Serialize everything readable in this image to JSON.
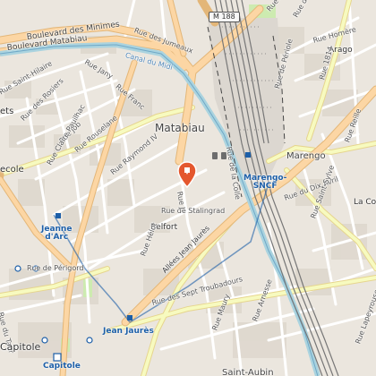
{
  "road_shield": "M 188",
  "labels": {
    "bd_minimes": "Boulevard des Minimes",
    "bd_matabiau": "Boulevard Matabiau",
    "canal_midi": "Canal du Midi",
    "rue_jumeaux": "Rue des Jumeaux",
    "rue_jany": "Rue Jany",
    "rue_franc": "Rue Franc",
    "rue_arago": "Rue Arago",
    "rue_homere": "Rue Homère",
    "arago": "Arago",
    "rue_peiriole": "Rue de Périole",
    "rue_1814": "Rue 1814",
    "rue_saint_hilaire": "Rue Saint-Hilaire",
    "rue_rosiers": "Rue des Rosiers",
    "rue_job": "Rue Job",
    "rue_claire_pauilhac": "Rue Claire Pauilhac",
    "rue_rouselane": "Rue Rouselane",
    "rue_raymond_iv": "Rue Raymond IV",
    "matabiau": "Matabiau",
    "marengo": "Marengo",
    "marengo_sncf": "Marengo-\nSNCF",
    "rue_dix_avril": "Rue du Dix Avril",
    "rue_reille": "Rue Reille",
    "la_colo": "La Colo",
    "rue_stalingrad": "Rue de Stalingrad",
    "belfort": "Belfort",
    "rue_helot": "Rue Hélot",
    "allees_jaures": "Allées Jean Jaurès",
    "jeanne_darc": "Jeanne\nd'Arc",
    "rue_perigord": "Rue de Périgord",
    "rue_sept_troubadours": "Rue des Sept Troubadours",
    "rue_arnesse": "Rue Arnesse",
    "rue_maury": "Rue Maury",
    "rue_saint_sylve": "Rue Saint-Sylve",
    "jean_jaures": "Jean Jaurès",
    "capitole_area": "Capitole",
    "capitole": "Capitole",
    "saint_aubin": "Saint-Aubin",
    "rue_du_taur": "Rue du Taur",
    "rue_la_coule": "Rue de la Colle",
    "ecole": "ecole",
    "ets": "ets",
    "rue_lapeyrouse": "Rue Lapeyrouse",
    "rue_tre": "Rue Tré",
    "rue_jour": "Rue J",
    "rue_bay": "Rue Bay",
    "rue_de_la": "Rue de la",
    "rue_lo": "Rue Lo"
  },
  "marker": {
    "type": "map-pin",
    "color": "#e4572e"
  },
  "colors": {
    "background": "#f2efe9",
    "primary_road": "#fcd6a4",
    "primary_road_edge": "#e3b678",
    "secondary_road": "#f7fabf",
    "canal": "#aad3df",
    "rail": "#777777",
    "station_area": "#e4e0da",
    "park": "#cdebb0",
    "metro": "#1d5fa8"
  }
}
